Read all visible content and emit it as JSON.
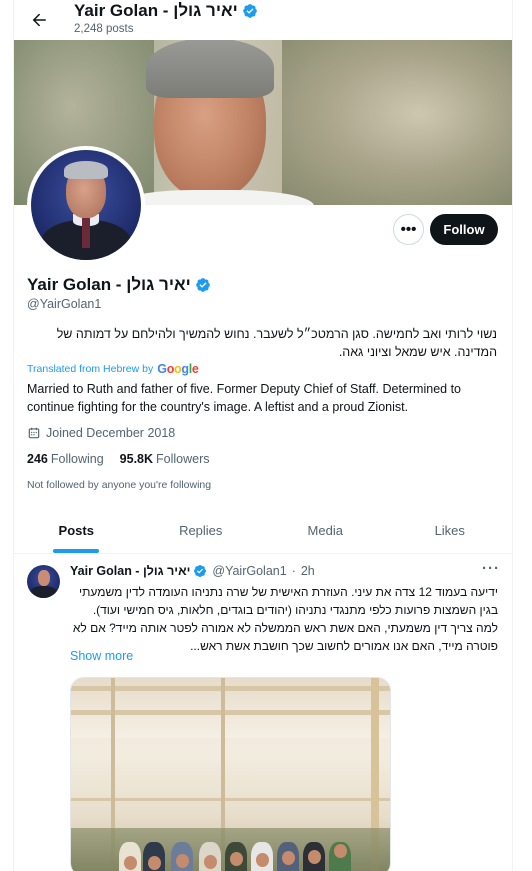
{
  "header": {
    "name": "Yair Golan - יאיר גולן",
    "posts_count": "2,248 posts"
  },
  "profile": {
    "name": "Yair Golan - יאיר גולן",
    "handle": "@YairGolan1",
    "bio_hebrew": "נשוי לרותי ואב לחמישה. סגן הרמטכ״ל לשעבר. נחוש להמשיך ולהילחם על דמותה של המדינה. איש שמאל וציוני גאה.",
    "translated_label": "Translated from Hebrew by",
    "translator_brand": [
      "G",
      "o",
      "o",
      "g",
      "l",
      "e"
    ],
    "bio_english": "Married to Ruth and father of five. Former Deputy Chief of Staff. Determined to continue fighting for the country's image. A leftist and a proud Zionist.",
    "joined": "Joined December 2018",
    "following_count": "246",
    "following_label": "Following",
    "followers_count": "95.8K",
    "followers_label": "Followers",
    "not_followed": "Not followed by anyone you're following",
    "follow_label": "Follow",
    "more_label": "•••"
  },
  "tabs": [
    {
      "label": "Posts",
      "active": true
    },
    {
      "label": "Replies",
      "active": false
    },
    {
      "label": "Media",
      "active": false
    },
    {
      "label": "Likes",
      "active": false
    }
  ],
  "tweet": {
    "name": "Yair Golan - יאיר גולן",
    "handle": "@YairGolan1",
    "sep": "·",
    "time": "2h",
    "dots": "···",
    "text": "ידיעה בעמוד 12 צדה את עיני. העוזרת האישית של שרה נתניהו העומדה לדין משמעתי בגין השמצות פרועות כלפי מתנגדי נתניהו (יהודים בוגדים, חלאות, גיס חמישי ועוד). למה צריך דין משמעתי, האם אשת ראש הממשלה לא אמורה לפטר אותה מייד? אם לא פוטרה מייד, האם אנו אמורים לחשוב שכך חושבת אשת ראש...",
    "show_more": "Show more"
  },
  "colors": {
    "accent": "#1d9bf0",
    "verified": "#1d9bf0",
    "text_primary": "#0f1419",
    "text_secondary": "#536471"
  },
  "icons": {
    "back": "arrow-left-icon",
    "verified": "verified-badge-icon",
    "calendar": "calendar-icon"
  }
}
